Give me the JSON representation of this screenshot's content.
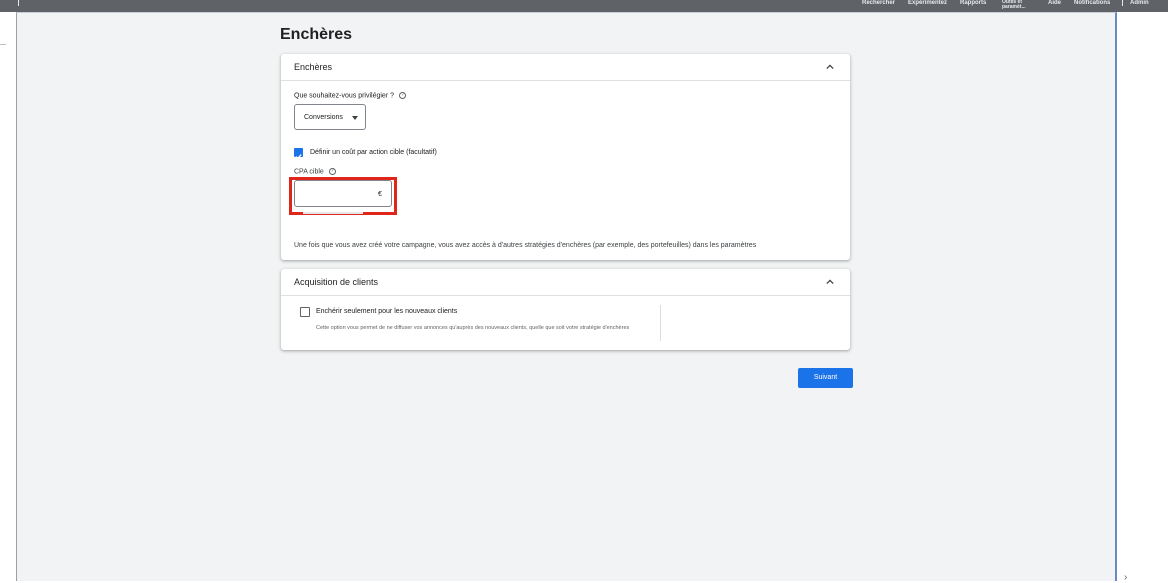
{
  "topbar": {
    "nav": [
      "Rechercher",
      "Expérimentez",
      "Rapports",
      "Outils et paramèt...",
      "Aide",
      "Notifications",
      "Admin"
    ]
  },
  "page": {
    "title": "Enchères"
  },
  "bidding_card": {
    "title": "Enchères",
    "question": "Que souhaitez-vous privilégier ?",
    "focus_select": {
      "value": "Conversions"
    },
    "target_cpa_checkbox": {
      "label": "Définir un coût par action cible (facultatif)",
      "checked": true
    },
    "cpa_label": "CPA cible",
    "cpa_input": {
      "value": "",
      "currency": "€"
    },
    "info": "Une fois que vous avez créé votre campagne, vous avez accès à d'autres stratégies d'enchères (par exemple, des portefeuilles) dans les paramètres"
  },
  "acquisition_card": {
    "title": "Acquisition de clients",
    "new_customers_checkbox": {
      "label": "Enchérir seulement pour les nouveaux clients",
      "checked": false,
      "description": "Cette option vous permet de ne diffuser vos annonces qu'auprès des nouveaux clients, quelle que soit votre stratégie d'enchères"
    }
  },
  "actions": {
    "next_label": "Suivant"
  },
  "colors": {
    "accent": "#1a73e8",
    "highlight": "#e0251b",
    "topbar": "#5f6368"
  }
}
